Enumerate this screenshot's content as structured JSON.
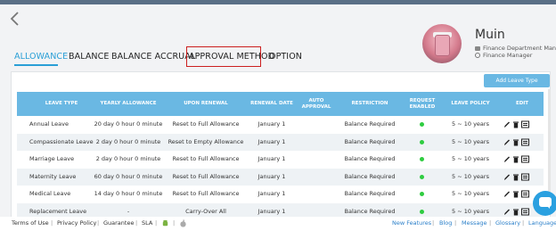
{
  "header": {
    "back_label": "",
    "user": {
      "name": "Muin",
      "department": "Finance Department Manager",
      "role": "Finance Manager"
    }
  },
  "tabs": [
    {
      "label": "ALLOWANCE",
      "active": true
    },
    {
      "label": "BALANCE",
      "active": false
    },
    {
      "label": "BALANCE ACCRUAL",
      "active": false
    },
    {
      "label": "APPROVAL METHOD",
      "active": false,
      "highlighted": true
    },
    {
      "label": "OPTION",
      "active": false
    }
  ],
  "toolbar": {
    "add_label": "Add Leave Type"
  },
  "table": {
    "headers": [
      "LEAVE TYPE",
      "YEARLY ALLOWANCE",
      "UPON RENEWAL",
      "RENEWAL DATE",
      "AUTO APPROVAL",
      "RESTRICTION",
      "REQUEST ENABLED",
      "LEAVE POLICY",
      "EDIT"
    ],
    "rows": [
      {
        "leave_type": "Annual Leave",
        "yearly": "20 day 0 hour 0 minute",
        "renewal": "Reset to Full Allowance",
        "date": "January 1",
        "auto": "",
        "restriction": "Balance Required",
        "enabled": true,
        "policy": "5 ~ 10 years"
      },
      {
        "leave_type": "Compassionate Leave",
        "yearly": "2 day 0 hour 0 minute",
        "renewal": "Reset to Empty Allowance",
        "date": "January 1",
        "auto": "",
        "restriction": "Balance Required",
        "enabled": true,
        "policy": "5 ~ 10 years"
      },
      {
        "leave_type": "Marriage Leave",
        "yearly": "2 day 0 hour 0 minute",
        "renewal": "Reset to Full Allowance",
        "date": "January 1",
        "auto": "",
        "restriction": "Balance Required",
        "enabled": true,
        "policy": "5 ~ 10 years"
      },
      {
        "leave_type": "Maternity Leave",
        "yearly": "60 day 0 hour 0 minute",
        "renewal": "Reset to Full Allowance",
        "date": "January 1",
        "auto": "",
        "restriction": "Balance Required",
        "enabled": true,
        "policy": "5 ~ 10 years"
      },
      {
        "leave_type": "Medical Leave",
        "yearly": "14 day 0 hour 0 minute",
        "renewal": "Reset to Full Allowance",
        "date": "January 1",
        "auto": "",
        "restriction": "Balance Required",
        "enabled": true,
        "policy": "5 ~ 10 years"
      },
      {
        "leave_type": "Replacement Leave",
        "yearly": "-",
        "renewal": "Carry-Over All",
        "date": "January 1",
        "auto": "",
        "restriction": "Balance Required",
        "enabled": true,
        "policy": "5 ~ 10 years"
      }
    ]
  },
  "footer": {
    "left": [
      "Terms of Use",
      "Privacy Policy",
      "Guarantee",
      "SLA"
    ],
    "right": [
      "New Features",
      "Blog",
      "Message",
      "Glossary",
      "Language"
    ]
  },
  "icons": {
    "back": "chevron-left-icon",
    "edit": "pencil-icon",
    "delete": "trash-icon",
    "detail": "list-icon",
    "android": "android-icon",
    "apple": "apple-icon",
    "chat": "chat-icon"
  },
  "colors": {
    "accent": "#2a9fd6",
    "header_bg": "#6ab8e3",
    "highlight_box": "#cc1f1f",
    "enabled_dot": "#2ecc40"
  }
}
